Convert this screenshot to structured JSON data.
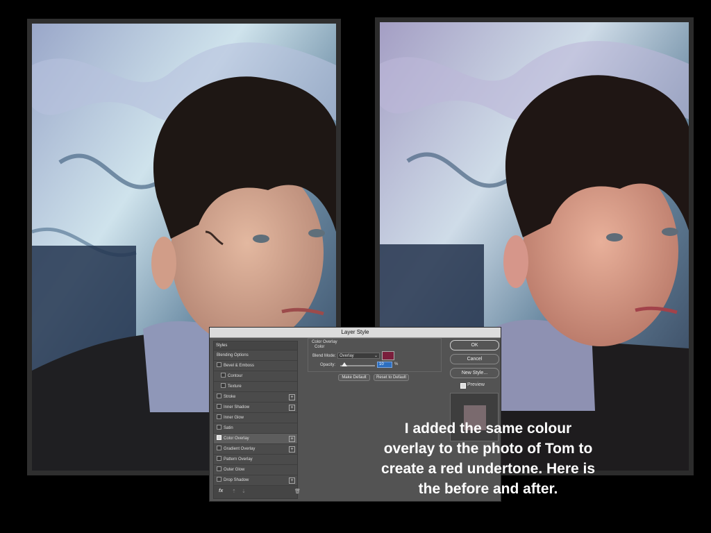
{
  "dialog": {
    "title": "Layer Style",
    "styles_header": "Styles",
    "style_items": [
      {
        "label": "Blending Options",
        "checkbox": false,
        "checked": false,
        "plus": false,
        "indent": false,
        "selected": false
      },
      {
        "label": "Bevel & Emboss",
        "checkbox": true,
        "checked": false,
        "plus": false,
        "indent": false,
        "selected": false
      },
      {
        "label": "Contour",
        "checkbox": true,
        "checked": false,
        "plus": false,
        "indent": true,
        "selected": false
      },
      {
        "label": "Texture",
        "checkbox": true,
        "checked": false,
        "plus": false,
        "indent": true,
        "selected": false
      },
      {
        "label": "Stroke",
        "checkbox": true,
        "checked": false,
        "plus": true,
        "indent": false,
        "selected": false
      },
      {
        "label": "Inner Shadow",
        "checkbox": true,
        "checked": false,
        "plus": true,
        "indent": false,
        "selected": false
      },
      {
        "label": "Inner Glow",
        "checkbox": true,
        "checked": false,
        "plus": false,
        "indent": false,
        "selected": false
      },
      {
        "label": "Satin",
        "checkbox": true,
        "checked": false,
        "plus": false,
        "indent": false,
        "selected": false
      },
      {
        "label": "Color Overlay",
        "checkbox": true,
        "checked": true,
        "plus": true,
        "indent": false,
        "selected": true
      },
      {
        "label": "Gradient Overlay",
        "checkbox": true,
        "checked": false,
        "plus": true,
        "indent": false,
        "selected": false
      },
      {
        "label": "Pattern Overlay",
        "checkbox": true,
        "checked": false,
        "plus": false,
        "indent": false,
        "selected": false
      },
      {
        "label": "Outer Glow",
        "checkbox": true,
        "checked": false,
        "plus": false,
        "indent": false,
        "selected": false
      },
      {
        "label": "Drop Shadow",
        "checkbox": true,
        "checked": false,
        "plus": true,
        "indent": false,
        "selected": false
      }
    ],
    "fx_label": "fx",
    "overlay": {
      "group_title": "Color Overlay",
      "subgroup_title": "Color",
      "blend_mode_label": "Blend Mode:",
      "blend_mode_value": "Overlay",
      "overlay_color": "#7a1f3c",
      "opacity_label": "Opacity:",
      "opacity_value": "10",
      "opacity_unit": "%",
      "make_default": "Make Default",
      "reset_default": "Reset to Default"
    },
    "buttons": {
      "ok": "OK",
      "cancel": "Cancel",
      "new_style": "New Style..."
    },
    "preview_label": "Preview",
    "preview_checked": true
  },
  "caption": "I added the same colour overlay to the photo of Tom to create a red undertone. Here is the before and after."
}
